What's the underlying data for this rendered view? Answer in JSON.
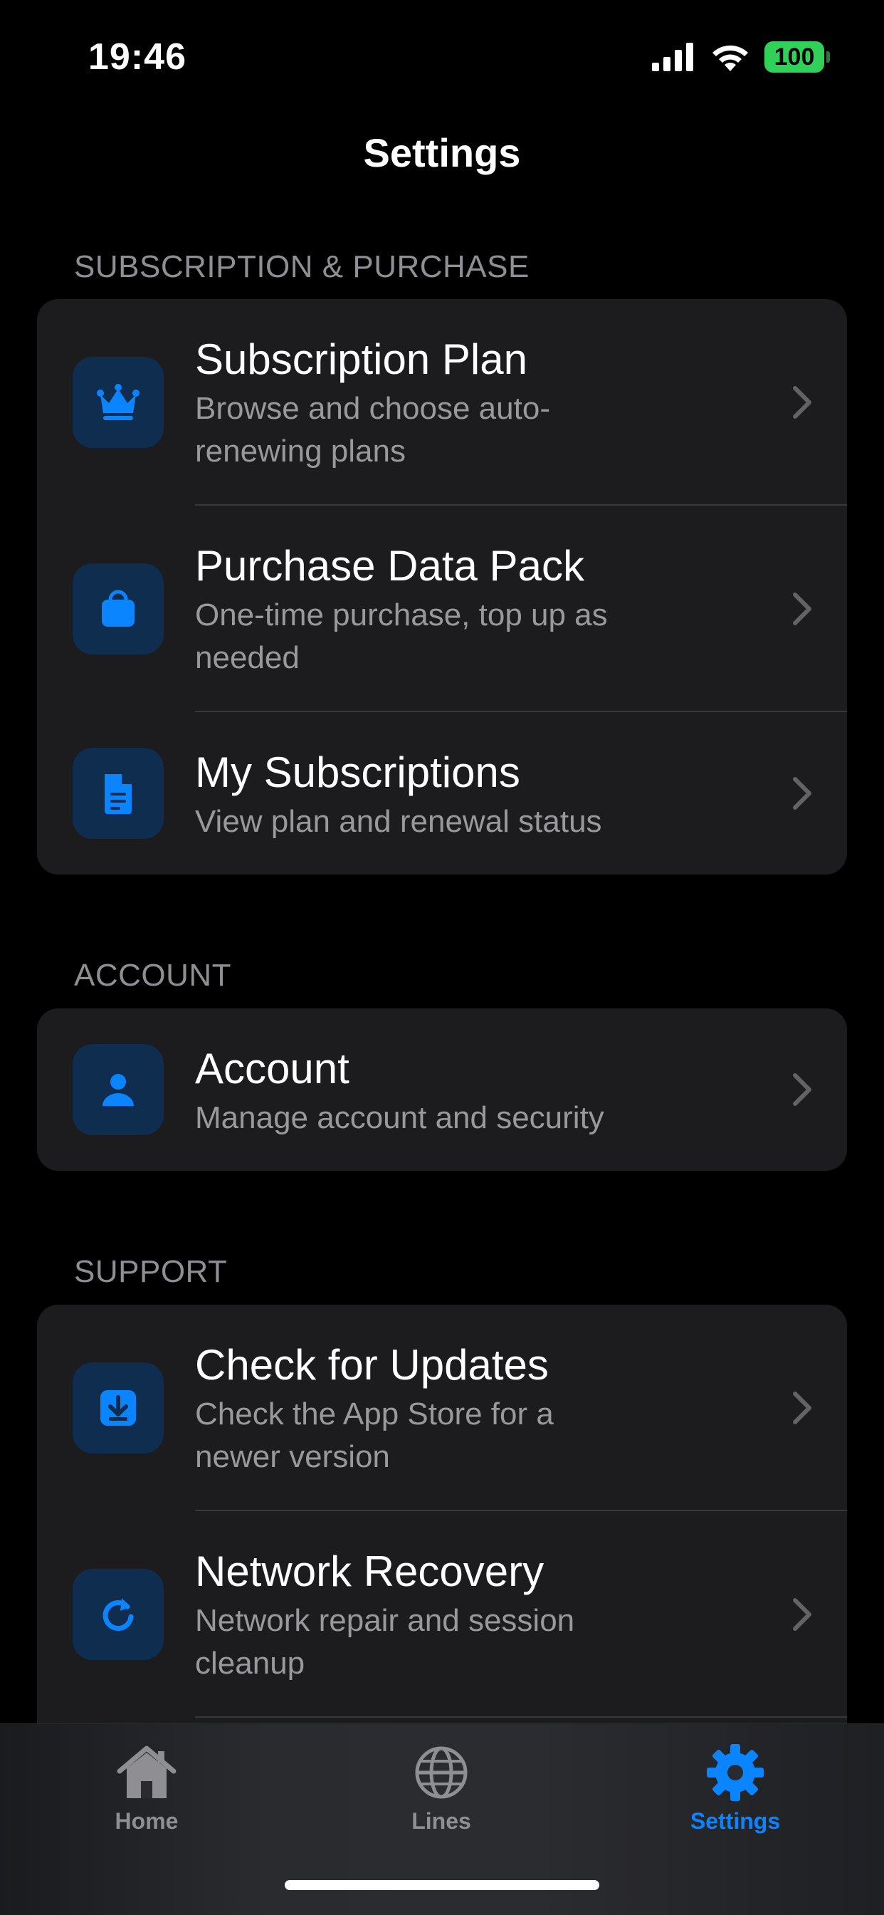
{
  "status_bar": {
    "time": "19:46",
    "battery": "100",
    "icons": [
      "cellular-signal-icon",
      "wifi-icon",
      "battery-icon"
    ]
  },
  "page": {
    "title": "Settings"
  },
  "sections": {
    "subscription": {
      "header": "SUBSCRIPTION & PURCHASE",
      "items": [
        {
          "title": "Subscription Plan",
          "subtitle": "Browse and choose auto-renewing plans",
          "icon": "crown-icon"
        },
        {
          "title": "Purchase Data Pack",
          "subtitle": "One-time purchase, top up as needed",
          "icon": "shopping-bag-icon"
        },
        {
          "title": "My Subscriptions",
          "subtitle": "View plan and renewal status",
          "icon": "document-icon"
        }
      ]
    },
    "account": {
      "header": "ACCOUNT",
      "items": [
        {
          "title": "Account",
          "subtitle": "Manage account and security",
          "icon": "person-icon"
        }
      ]
    },
    "support": {
      "header": "SUPPORT",
      "items": [
        {
          "title": "Check for Updates",
          "subtitle": "Check the App Store for a newer version",
          "icon": "download-icon"
        },
        {
          "title": "Network Recovery",
          "subtitle": "Network repair and session cleanup",
          "icon": "refresh-icon"
        }
      ]
    }
  },
  "tab_bar": {
    "tabs": [
      {
        "label": "Home",
        "icon": "house-icon",
        "active": false
      },
      {
        "label": "Lines",
        "icon": "globe-icon",
        "active": false
      },
      {
        "label": "Settings",
        "icon": "gear-icon",
        "active": true
      }
    ]
  },
  "colors": {
    "accent": "#0a84ff",
    "background": "#000000",
    "card": "#1c1c1e",
    "icon_tile": "#0f2d4e",
    "secondary_text": "#98989d",
    "battery": "#30d158"
  }
}
